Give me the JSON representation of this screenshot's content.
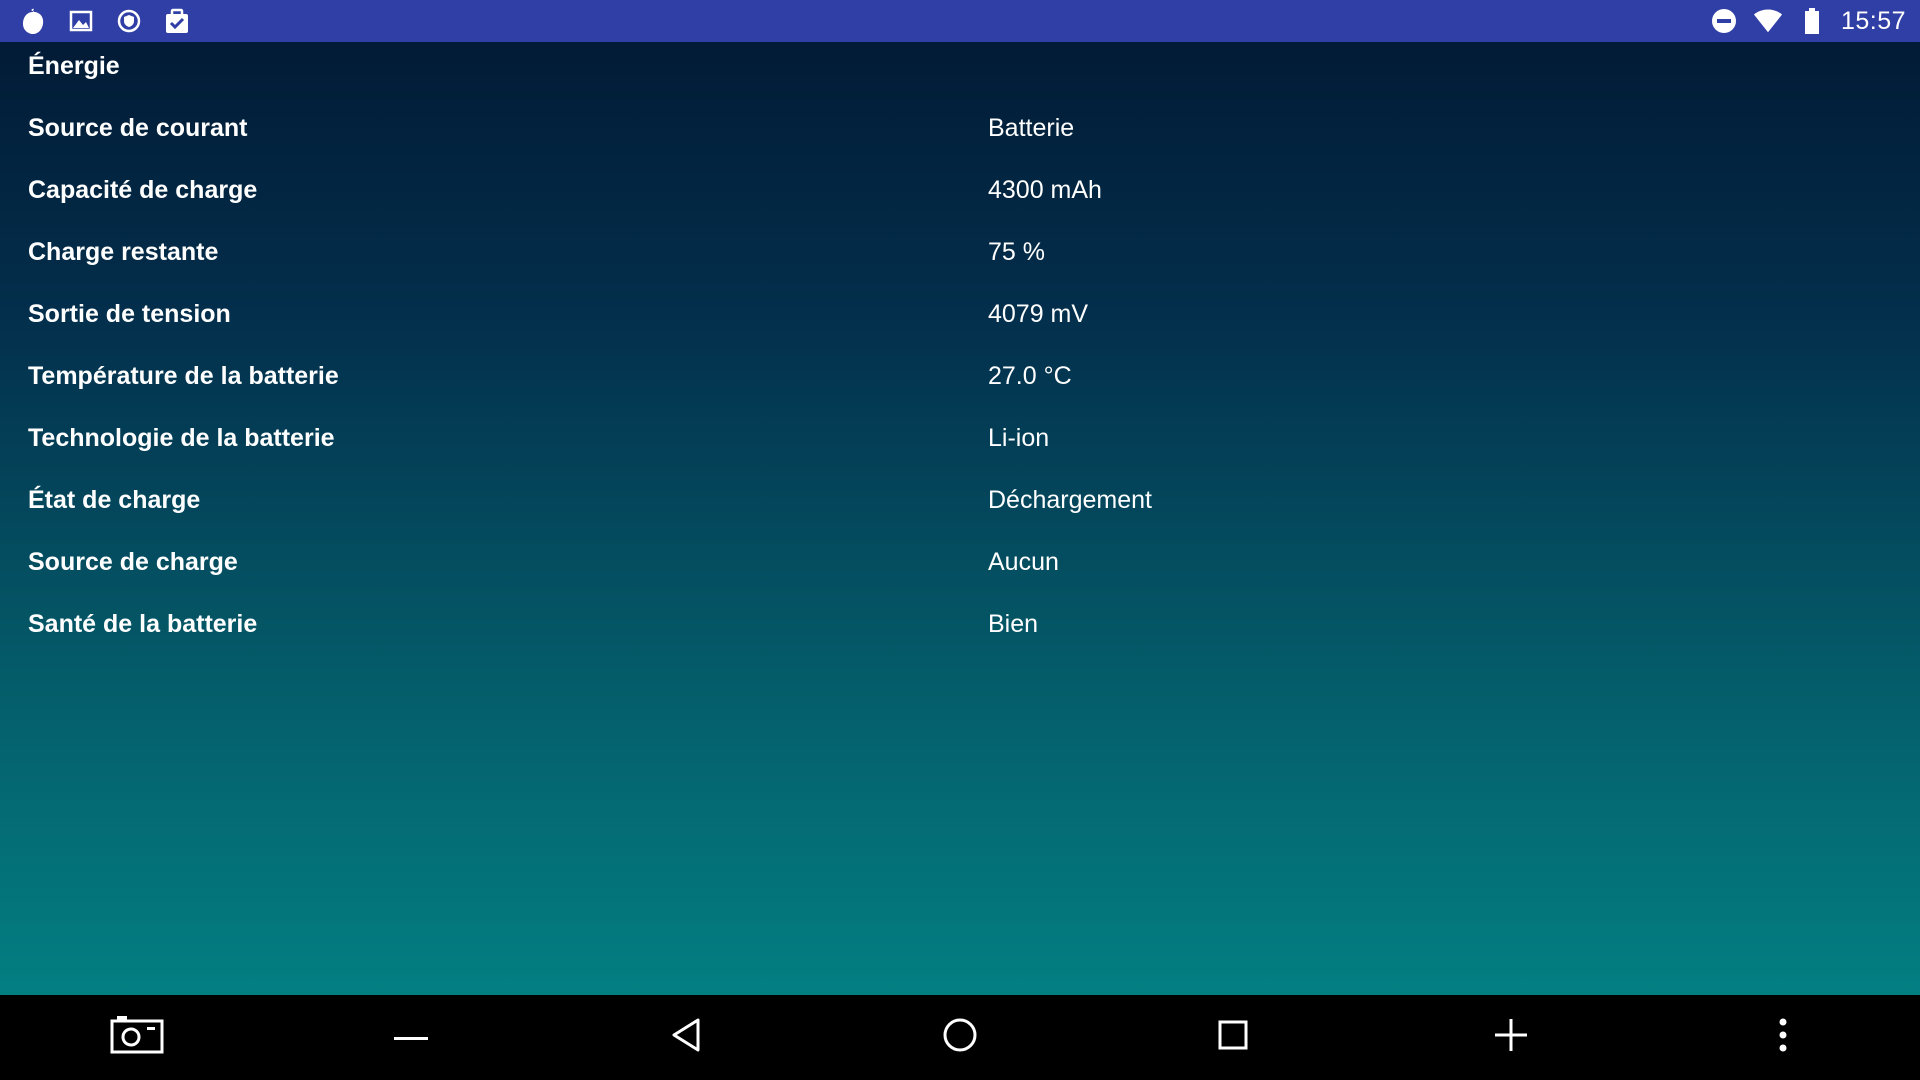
{
  "status_bar": {
    "left_icons": [
      "notification-app-icon",
      "image-icon",
      "vpn-shield-icon",
      "clipboard-check-icon"
    ],
    "right_icons": [
      "do-not-disturb-icon",
      "wifi-icon",
      "battery-icon"
    ],
    "time": "15:57",
    "background_color": "#303fa6"
  },
  "main": {
    "section_title": "Énergie",
    "rows": [
      {
        "label": "Source de courant",
        "value": "Batterie"
      },
      {
        "label": "Capacité de charge",
        "value": "4300 mAh"
      },
      {
        "label": "Charge restante",
        "value": "75 %"
      },
      {
        "label": "Sortie de tension",
        "value": "4079 mV"
      },
      {
        "label": "Température de la batterie",
        "value": "27.0 °C"
      },
      {
        "label": "Technologie de la batterie",
        "value": "Li-ion"
      },
      {
        "label": "État de charge",
        "value": "Déchargement"
      },
      {
        "label": "Source de charge",
        "value": "Aucun"
      },
      {
        "label": "Santé de la batterie",
        "value": "Bien"
      }
    ]
  },
  "nav_bar": {
    "buttons": [
      "screenshot-icon",
      "volume-down-icon",
      "back-icon",
      "home-icon",
      "recents-icon",
      "volume-up-icon",
      "more-options-icon"
    ]
  }
}
